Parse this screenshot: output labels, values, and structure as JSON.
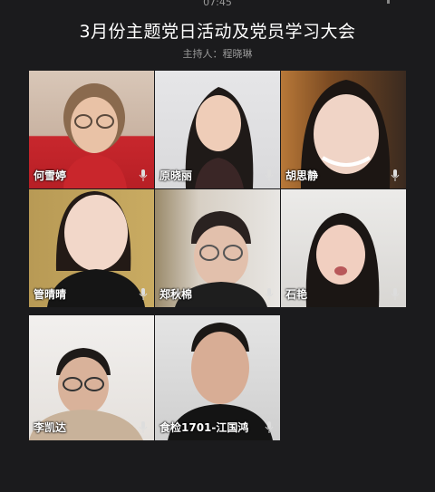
{
  "status": {
    "time": "07:45"
  },
  "meeting": {
    "title": "3月份主题党日活动及党员学习大会",
    "host": "主持人：程晓琳"
  },
  "participants": [
    {
      "name": "何雪婷"
    },
    {
      "name": "原晓丽"
    },
    {
      "name": "胡思静"
    },
    {
      "name": "管晴晴"
    },
    {
      "name": "郑秋棉"
    },
    {
      "name": "石艳"
    },
    {
      "name": "李凯达"
    },
    {
      "name": "食检1701-江国鸿"
    }
  ],
  "colors": {
    "background": "#1b1b1d",
    "title_text": "#ffffff",
    "subtitle_text": "#9a9a9a"
  }
}
